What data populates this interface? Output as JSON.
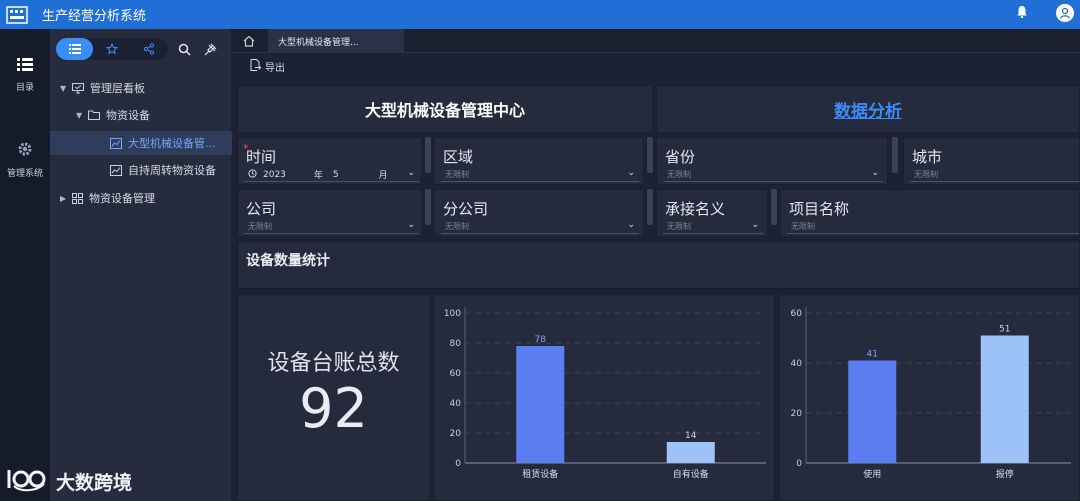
{
  "app": {
    "title": "生产经营分析系统"
  },
  "rail": [
    {
      "label": "目录",
      "icon": "list-icon"
    },
    {
      "label": "管理系统",
      "icon": "gear-icon"
    }
  ],
  "tree": {
    "nodes": [
      {
        "label": "管理层看板",
        "icon": "dashboard-icon",
        "expanded": true
      },
      {
        "label": "物资设备",
        "icon": "folder-icon",
        "expanded": true
      },
      {
        "label": "大型机械设备管...",
        "icon": "chart-icon",
        "active": true
      },
      {
        "label": "自持周转物资设备",
        "icon": "chart-icon"
      },
      {
        "label": "物资设备管理",
        "icon": "grid-icon",
        "expanded": false
      }
    ]
  },
  "tabs": {
    "active": "大型机械设备管理..."
  },
  "toolbar": {
    "export_label": "导出"
  },
  "header": {
    "title": "大型机械设备管理中心",
    "link": "数据分析"
  },
  "filters": {
    "time": {
      "label": "时间",
      "required_mark": "*",
      "year": "2023",
      "year_unit": "年",
      "month": "5",
      "month_unit": "月"
    },
    "region": {
      "label": "区域",
      "value": "无限制"
    },
    "province": {
      "label": "省份",
      "value": "无限制"
    },
    "city": {
      "label": "城市",
      "value": "无限制"
    },
    "company": {
      "label": "公司",
      "value": "无限制"
    },
    "branch": {
      "label": "分公司",
      "value": "无限制"
    },
    "contractor": {
      "label": "承接名义",
      "value": "无限制"
    },
    "project": {
      "label": "项目名称",
      "value": "无限制"
    }
  },
  "section": {
    "title": "设备数量统计"
  },
  "kpi": {
    "label": "设备台账总数",
    "value": "92"
  },
  "colors": {
    "accent": "#1f6fd6",
    "bar_primary": "#5b7ff2",
    "bar_secondary": "#9cc2f8"
  },
  "chart_data": [
    {
      "type": "bar",
      "categories": [
        "租赁设备",
        "自有设备"
      ],
      "values": [
        78,
        14
      ],
      "y_ticks": [
        0,
        20,
        40,
        60,
        80,
        100
      ],
      "ylim": [
        0,
        100
      ],
      "title": "",
      "xlabel": "",
      "ylabel": ""
    },
    {
      "type": "bar",
      "categories": [
        "使用",
        "报停"
      ],
      "values": [
        41,
        51
      ],
      "y_ticks": [
        0,
        20,
        40,
        60
      ],
      "ylim": [
        0,
        60
      ],
      "title": "",
      "xlabel": "",
      "ylabel": ""
    }
  ],
  "watermark": {
    "text": "大数跨境"
  }
}
